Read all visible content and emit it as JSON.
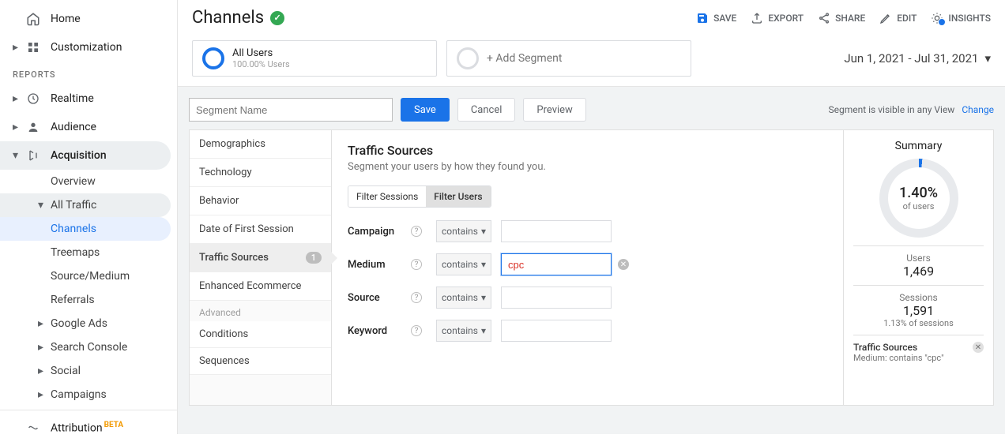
{
  "page": {
    "title": "Channels"
  },
  "top_actions": {
    "save": "SAVE",
    "export": "EXPORT",
    "share": "SHARE",
    "edit": "EDIT",
    "insights": "INSIGHTS"
  },
  "nav": {
    "top": [
      {
        "label": "Home"
      },
      {
        "label": "Customization"
      }
    ],
    "reports_label": "REPORTS",
    "sections": [
      {
        "label": "Realtime"
      },
      {
        "label": "Audience"
      },
      {
        "label": "Acquisition"
      }
    ],
    "acquisition_children": {
      "overview": "Overview",
      "all_traffic": "All Traffic",
      "channels": "Channels",
      "treemaps": "Treemaps",
      "source_medium": "Source/Medium",
      "referrals": "Referrals",
      "google_ads": "Google Ads",
      "search_console": "Search Console",
      "social": "Social",
      "campaigns": "Campaigns"
    },
    "attribution": {
      "label": "Attribution",
      "badge": "BETA"
    }
  },
  "segments": {
    "all_users": {
      "title": "All Users",
      "subtitle": "100.00% Users"
    },
    "add": "+ Add Segment"
  },
  "date_range": "Jun 1, 2021 - Jul 31, 2021",
  "builder": {
    "segment_name_placeholder": "Segment Name",
    "save": "Save",
    "cancel": "Cancel",
    "preview": "Preview",
    "visibility": "Segment is visible in any View",
    "change": "Change",
    "sidebar": {
      "demographics": "Demographics",
      "technology": "Technology",
      "behavior": "Behavior",
      "date_first": "Date of First Session",
      "traffic_sources": "Traffic Sources",
      "traffic_sources_count": "1",
      "enhanced_ecom": "Enhanced Ecommerce",
      "advanced": "Advanced",
      "conditions": "Conditions",
      "sequences": "Sequences"
    },
    "main": {
      "title": "Traffic Sources",
      "subtitle": "Segment your users by how they found you.",
      "filter_sessions": "Filter Sessions",
      "filter_users": "Filter Users",
      "rows": {
        "campaign": {
          "label": "Campaign",
          "op": "contains",
          "value": ""
        },
        "medium": {
          "label": "Medium",
          "op": "contains",
          "value": "cpc"
        },
        "source": {
          "label": "Source",
          "op": "contains",
          "value": ""
        },
        "keyword": {
          "label": "Keyword",
          "op": "contains",
          "value": ""
        }
      }
    }
  },
  "summary": {
    "title": "Summary",
    "percent": "1.40%",
    "of_users": "of users",
    "users_label": "Users",
    "users_value": "1,469",
    "sessions_label": "Sessions",
    "sessions_value": "1,591",
    "sessions_note": "1.13% of sessions",
    "filter_name": "Traffic Sources",
    "filter_desc": "Medium: contains \"cpc\""
  }
}
